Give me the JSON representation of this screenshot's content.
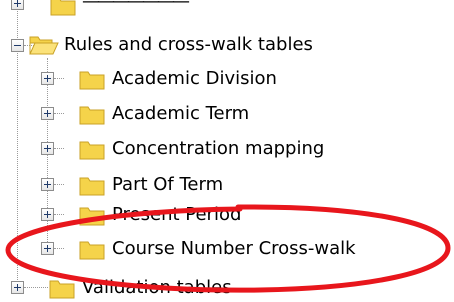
{
  "tree": {
    "top_item": {
      "label": "———————"
    },
    "group": {
      "label": "Rules and cross-walk tables",
      "expanded": true,
      "children": [
        {
          "label": "Academic Division"
        },
        {
          "label": "Academic Term"
        },
        {
          "label": "Concentration mapping"
        },
        {
          "label": "Part Of Term"
        },
        {
          "label": "Present Period"
        },
        {
          "label": "Course Number Cross-walk"
        }
      ]
    },
    "bottom_item": {
      "label": "Validation tables"
    }
  },
  "colors": {
    "folder_fill": "#f5d34a",
    "folder_edge": "#c9a227",
    "highlight_ellipse": "#e8161c",
    "guide_lines": "#9a9a9a"
  },
  "icons": {
    "collapsed": "plus-expander-icon",
    "expanded": "minus-expander-icon",
    "folder": "folder-icon",
    "open_folder": "open-folder-icon"
  }
}
